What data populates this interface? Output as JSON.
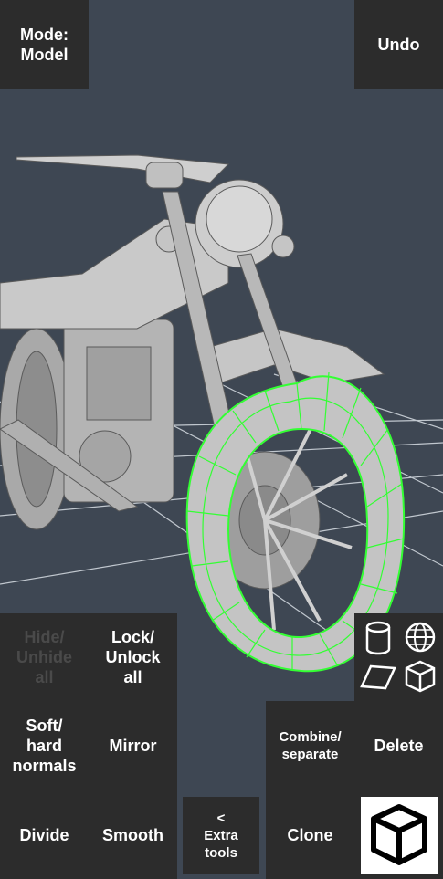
{
  "toolbar": {
    "mode_label": "Mode:\nModel",
    "undo_label": "Undo"
  },
  "grid_buttons": {
    "hide_unhide": "Hide/\nUnhide\nall",
    "lock_unlock": "Lock/\nUnlock\nall",
    "soft_hard": "Soft/\nhard\nnormals",
    "mirror": "Mirror",
    "combine_separate": "Combine/\nseparate",
    "delete": "Delete",
    "divide": "Divide",
    "smooth": "Smooth",
    "extra_tools": "<\nExtra\ntools",
    "clone": "Clone"
  },
  "primitives": [
    "cylinder-icon",
    "sphere-icon",
    "plane-icon",
    "cube-icon"
  ],
  "colors": {
    "background": "#3e4753",
    "button": "#2c2c2c",
    "selection": "#33ff33",
    "model": "#c8c8c8"
  }
}
